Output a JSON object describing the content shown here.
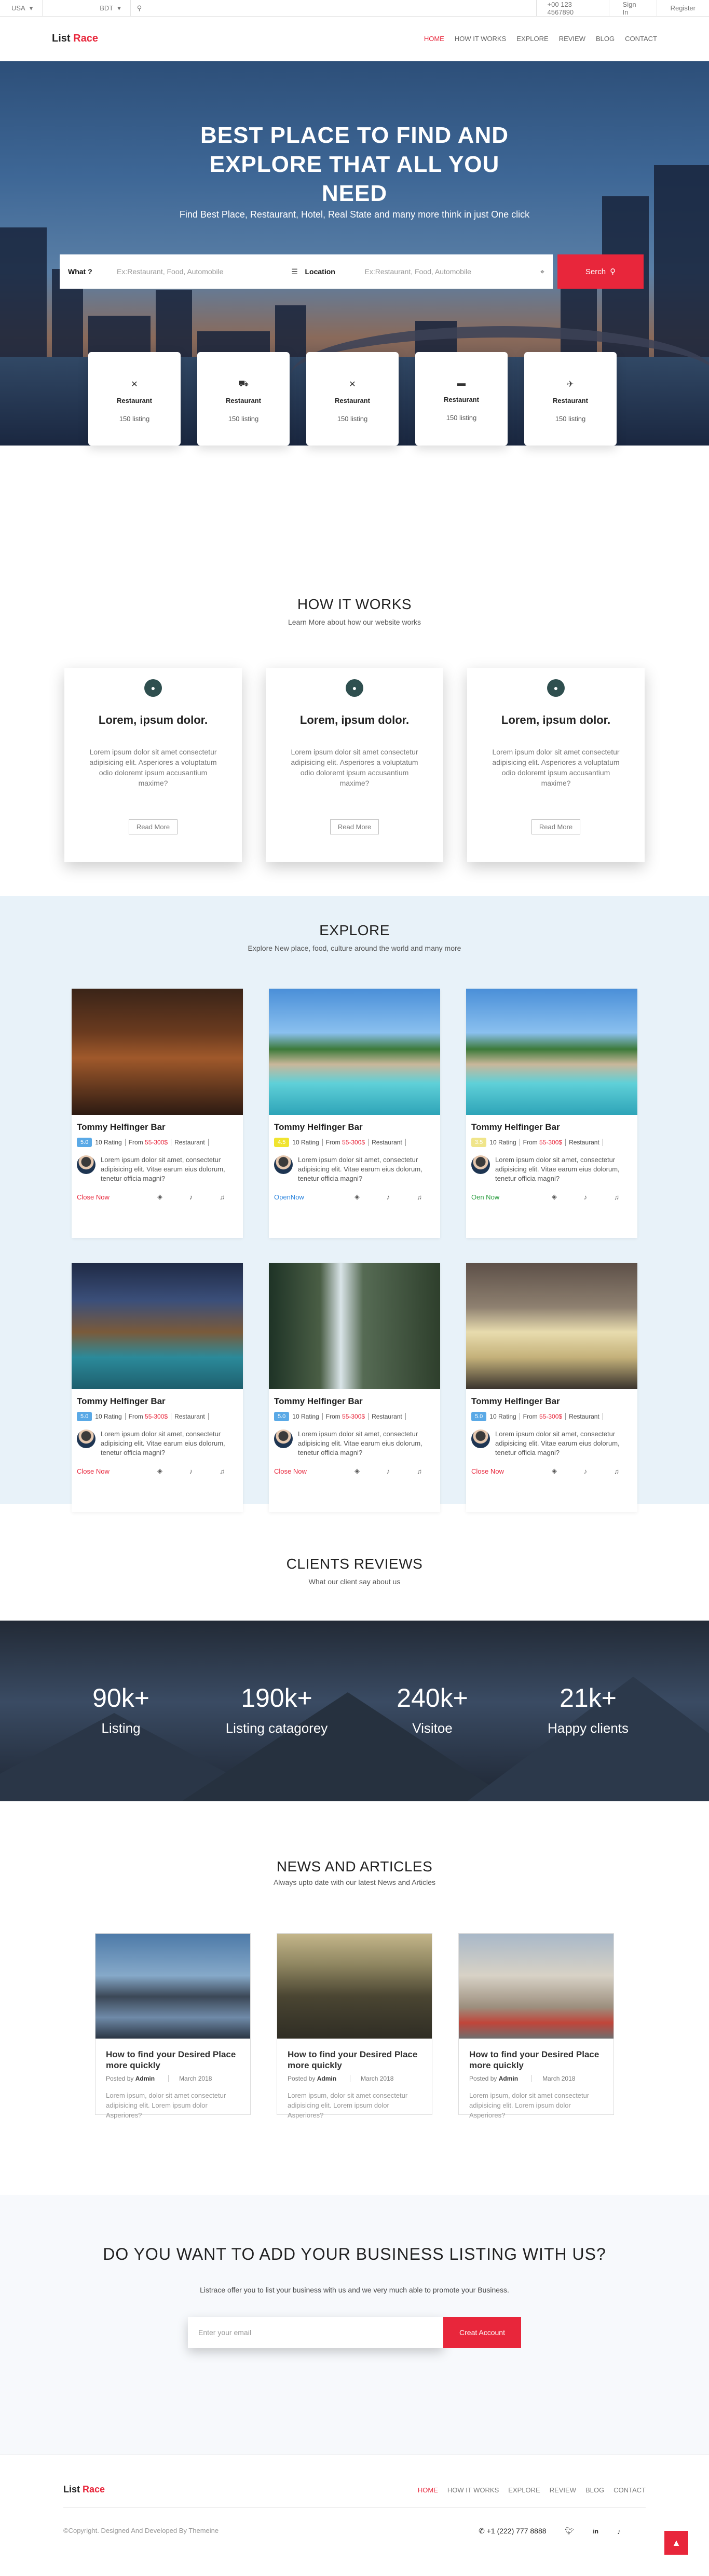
{
  "topbar": {
    "country": "USA",
    "currency": "BDT",
    "phone": "+00 123 4567890",
    "signin": "Sign In",
    "register": "Register"
  },
  "nav": {
    "logo_a": "List",
    "logo_b": "Race",
    "links": [
      "Home",
      "HOW IT WORKS",
      "EXPLORE",
      "REVIEW",
      "BLOG",
      "CONTACT"
    ]
  },
  "hero": {
    "title": "BEST PLACE TO FIND AND EXPLORE THAT ALL YOU NEED",
    "subtitle": "Find Best Place, Restaurant, Hotel, Real State and many more think in just One click",
    "what_label": "What ?",
    "what_placeholder": "Ex:Restaurant, Food, Automobile",
    "location_label": "Location",
    "location_placeholder": "Ex:Restaurant, Food, Automobile",
    "search_label": "Serch"
  },
  "categories": [
    {
      "name": "Restaurant",
      "count": "150 listing",
      "icon": "utensils-icon"
    },
    {
      "name": "Restaurant",
      "count": "150 listing",
      "icon": "car-icon"
    },
    {
      "name": "Restaurant",
      "count": "150 listing",
      "icon": "utensils-icon"
    },
    {
      "name": "Restaurant",
      "count": "150 listing",
      "icon": "bed-icon"
    },
    {
      "name": "Restaurant",
      "count": "150 listing",
      "icon": "plane-icon"
    }
  ],
  "how": {
    "title": "HOW IT WORKS",
    "subtitle": "Learn More about how our website works",
    "cards": [
      {
        "title": "Lorem, ipsum dolor.",
        "text": "Lorem ipsum dolor sit amet consectetur adipisicing elit. Asperiores a voluptatum odio doloremt ipsum accusantium maxime?",
        "button": "Read More"
      },
      {
        "title": "Lorem, ipsum dolor.",
        "text": "Lorem ipsum dolor sit amet consectetur adipisicing elit. Asperiores a voluptatum odio doloremt ipsum accusantium maxime?",
        "button": "Read More"
      },
      {
        "title": "Lorem, ipsum dolor.",
        "text": "Lorem ipsum dolor sit amet consectetur adipisicing elit. Asperiores a voluptatum odio doloremt ipsum accusantium maxime?",
        "button": "Read More"
      }
    ]
  },
  "explore": {
    "title": "EXPLORE",
    "subtitle": "Explore New place, food, culture around the world and many more",
    "cards": [
      {
        "name": "Tommy Helfinger Bar",
        "rating": "5.0",
        "rating_color": "#5aa9e6",
        "rating_label": "10 Rating",
        "price_prefix": "From",
        "price": "55-300$",
        "tag": "Restaurant",
        "desc": "Lorem ipsum dolor sit amet, consectetur adipisicing elit. Vitae earum eius dolorum, tenetur officia magni?",
        "status": "Close Now",
        "status_color": "#e8263b",
        "img": "bar"
      },
      {
        "name": "Tommy Helfinger Bar",
        "rating": "4.5",
        "rating_color": "#f0e430",
        "rating_label": "10 Rating",
        "price_prefix": "From",
        "price": "55-300$",
        "tag": "Restaurant",
        "desc": "Lorem ipsum dolor sit amet, consectetur adipisicing elit. Vitae earum eius dolorum, tenetur officia magni?",
        "status": "OpenNow",
        "status_color": "#2e86de",
        "img": "pool"
      },
      {
        "name": "Tommy Helfinger Bar",
        "rating": "3.5",
        "rating_color": "#f0e58a",
        "rating_label": "10 Rating",
        "price_prefix": "From",
        "price": "55-300$",
        "tag": "Restaurant",
        "desc": "Lorem ipsum dolor sit amet, consectetur adipisicing elit. Vitae earum eius dolorum, tenetur officia magni?",
        "status": "Oen Now",
        "status_color": "#2a9d3f",
        "img": "pool"
      },
      {
        "name": "Tommy Helfinger Bar",
        "rating": "5.0",
        "rating_color": "#5aa9e6",
        "rating_label": "10 Rating",
        "price_prefix": "From",
        "price": "55-300$",
        "tag": "Restaurant",
        "desc": "Lorem ipsum dolor sit amet, consectetur adipisicing elit. Vitae earum eius dolorum, tenetur officia magni?",
        "status": "Close Now",
        "status_color": "#e8263b",
        "img": "house"
      },
      {
        "name": "Tommy Helfinger Bar",
        "rating": "5.0",
        "rating_color": "#5aa9e6",
        "rating_label": "10 Rating",
        "price_prefix": "From",
        "price": "55-300$",
        "tag": "Restaurant",
        "desc": "Lorem ipsum dolor sit amet, consectetur adipisicing elit. Vitae earum eius dolorum, tenetur officia magni?",
        "status": "Close Now",
        "status_color": "#e8263b",
        "img": "waterfall"
      },
      {
        "name": "Tommy Helfinger Bar",
        "rating": "5.0",
        "rating_color": "#5aa9e6",
        "rating_label": "10 Rating",
        "price_prefix": "From",
        "price": "55-300$",
        "tag": "Restaurant",
        "desc": "Lorem ipsum dolor sit amet, consectetur adipisicing elit. Vitae earum eius dolorum, tenetur officia magni?",
        "status": "Close Now",
        "status_color": "#e8263b",
        "img": "car"
      }
    ]
  },
  "reviews": {
    "title": "CLIENTS REVIEWS",
    "subtitle": "What our client say about us"
  },
  "stats": [
    {
      "value": "90k+",
      "label": "Listing"
    },
    {
      "value": "190k+",
      "label": "Listing catagorey"
    },
    {
      "value": "240k+",
      "label": "Visitoe"
    },
    {
      "value": "21k+",
      "label": "Happy clients"
    }
  ],
  "news": {
    "title": "NEWS AND ARTICLES",
    "subtitle": "Always upto date with our latest News and Articles",
    "cards": [
      {
        "title": "How to find your Desired Place more quickly",
        "posted": "Posted by",
        "author": "Admin",
        "date": "March 2018",
        "desc": "Lorem ipsum, dolor sit amet consectetur adipisicing elit. Lorem ipsum dolor Asperiores?",
        "img": "city"
      },
      {
        "title": "How to find your Desired Place more quickly",
        "posted": "Posted by",
        "author": "Admin",
        "date": "March 2018",
        "desc": "Lorem ipsum, dolor sit amet consectetur adipisicing elit. Lorem ipsum dolor Asperiores?",
        "img": "rooftop"
      },
      {
        "title": "How to find your Desired Place more quickly",
        "posted": "Posted by",
        "author": "Admin",
        "date": "March 2018",
        "desc": "Lorem ipsum, dolor sit amet consectetur adipisicing elit. Lorem ipsum dolor Asperiores?",
        "img": "museum"
      }
    ]
  },
  "cta": {
    "title": "DO YOU WANT TO ADD YOUR BUSINESS LISTING WITH US?",
    "text": "Listrace offer you to list your business with us and we very much able to promote your Business.",
    "placeholder": "Enter your email",
    "button": "Creat Account"
  },
  "footer": {
    "logo_a": "List",
    "logo_b": "Race",
    "links": [
      "Home",
      "HOW IT WORKS",
      "EXPLORE",
      "REVIEW",
      "BLOG",
      "CONTACT"
    ],
    "copyright": "©Copyright. Designed And Developed By Themeine",
    "phone": "+1 (222) 777 8888"
  },
  "colors": {
    "accent": "#e8263b",
    "explore_bg": "#e8f2f9"
  }
}
